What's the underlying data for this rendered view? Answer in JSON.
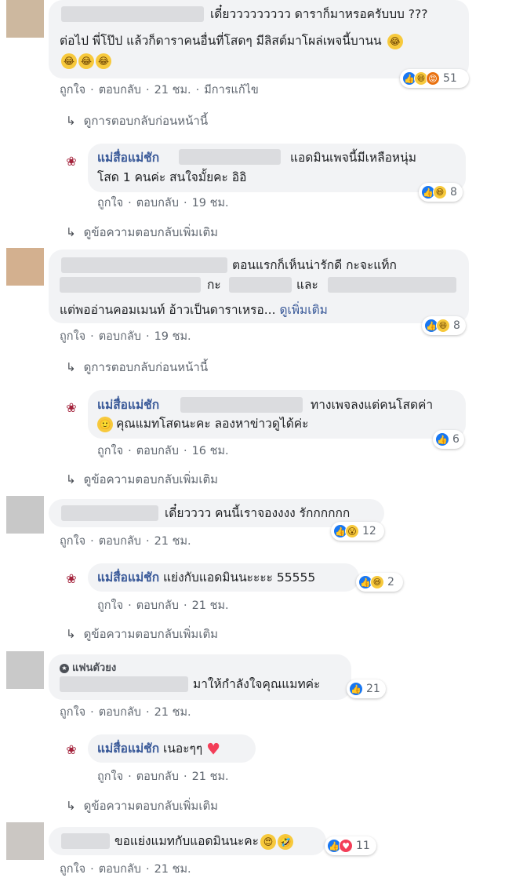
{
  "actions": {
    "like": "ถูกใจ",
    "reply": "ตอบกลับ",
    "sep": "·",
    "edited": "มีการแก้ไข"
  },
  "links": {
    "prev_replies": "ดูการตอบกลับก่อนหน้านี้",
    "more_replies": "ดูข้อความตอบกลับเพิ่มเติม"
  },
  "page_name": "แม่สื่อแม่ชัก",
  "c1": {
    "line1": "เดี๋ยววววววววว ดาราก็มาหรอครับบบ ???",
    "line2": "ต่อไป พี่โป๊ป แล้วก็ดาราคนอื่นที่โสดๆ มีลิสต์มาโผล่เพจนี้บานน",
    "time": "21 ชม.",
    "reactions": "51"
  },
  "r1": {
    "line1": "แอดมินเพจนี้มีเหลือหนุ่ม",
    "line2": "โสด 1 คนค่ะ สนใจมั้ยคะ อิอิ",
    "time": "19 ชม.",
    "reactions": "8"
  },
  "c2": {
    "line1": "ตอนแรกก็เห็นน่ารักดี กะจะแท็ก",
    "mid1": "กะ",
    "mid2": "และ",
    "line3": "แต่พออ่านคอมเมนท์ อ้าวเป็นดาราเหรอ...",
    "see_more": "ดูเพิ่มเติม",
    "time": "19 ชม.",
    "reactions": "8"
  },
  "r2": {
    "line1": "ทางเพจลงแต่คนโสดค่า",
    "line2": "คุณแมทโสดนะคะ ลองหาข่าวดูได้ค่ะ",
    "time": "16 ชม.",
    "reactions": "6"
  },
  "c3": {
    "text": "เดี๋ยวววว คนนี้เราจองงงง รักกกกกก",
    "time": "21 ชม.",
    "reactions": "12"
  },
  "r3": {
    "text": "แย่งกับแอดมินนะะะะ 55555",
    "time": "21 ชม.",
    "reactions": "2"
  },
  "c4": {
    "fan_badge": "แฟนตัวยง",
    "text": "มาให้กำลังใจคุณแมทค่ะ",
    "time": "21 ชม.",
    "reactions": "21"
  },
  "r4": {
    "text": "เนอะๆๆ",
    "time": "21 ชม."
  },
  "c5": {
    "text": "ขอแย่งแมทกับแอดมินนะคะ",
    "time": "21 ชม.",
    "reactions": "11"
  }
}
